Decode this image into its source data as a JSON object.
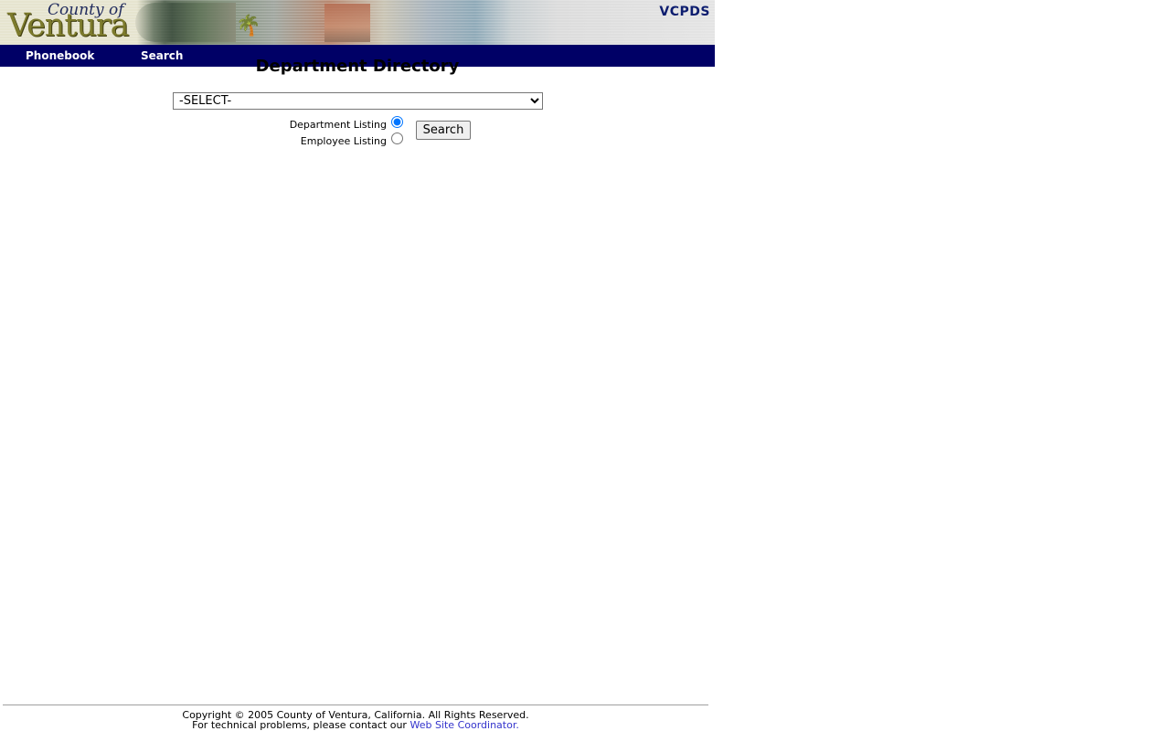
{
  "header": {
    "logo": {
      "line1": "County of",
      "line2": "Ventura"
    },
    "app_name": "VCPDS",
    "palm_icon": "palm-tree-icon"
  },
  "nav": {
    "items": [
      {
        "label": "Phonebook"
      },
      {
        "label": "Search"
      }
    ]
  },
  "main": {
    "title": "Department Directory",
    "select": {
      "selected": "-SELECT-",
      "options": [
        "-SELECT-"
      ]
    },
    "listing_type": {
      "options": [
        {
          "label": "Department Listing",
          "checked": true
        },
        {
          "label": "Employee Listing",
          "checked": false
        }
      ]
    },
    "search_button_label": "Search"
  },
  "footer": {
    "copyright": "Copyright © 2005 County of Ventura, California. All Rights Reserved.",
    "contact_prefix": "For technical problems, please contact our ",
    "contact_link": "Web Site Coordinator.",
    "link_color": "#3333cc"
  },
  "colors": {
    "nav_background": "#000066",
    "app_name": "#0d1d6f"
  }
}
